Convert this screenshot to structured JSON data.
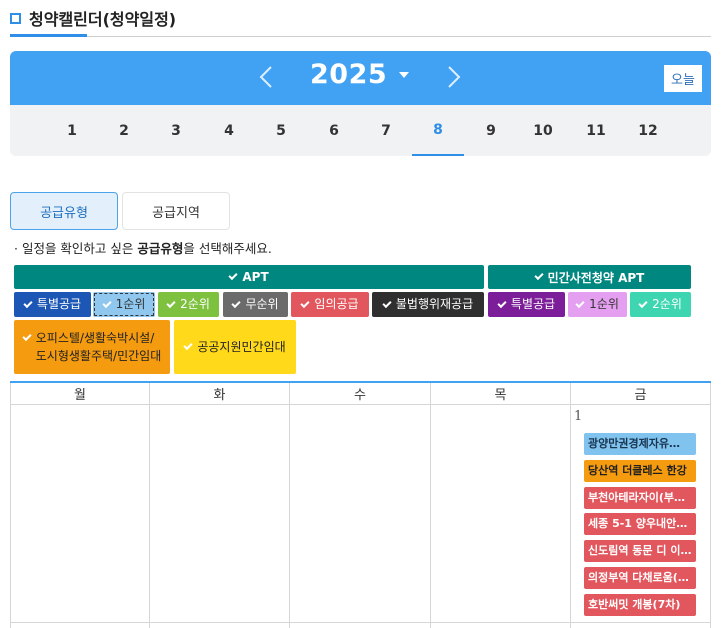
{
  "page_title": "청약캘린더(청약일정)",
  "calendar": {
    "year": "2025",
    "today_label": "오늘",
    "months": [
      "1",
      "2",
      "3",
      "4",
      "5",
      "6",
      "7",
      "8",
      "9",
      "10",
      "11",
      "12"
    ],
    "selected_month": "8"
  },
  "tabs": [
    {
      "label": "공급유형",
      "active": true
    },
    {
      "label": "공급지역",
      "active": false
    }
  ],
  "instruction": {
    "prefix": "· 일정을 확인하고 싶은 ",
    "bold": "공급유형",
    "suffix": "을 선택해주세요."
  },
  "filter_groups": [
    {
      "label": "APT"
    },
    {
      "label": "민간사전청약 APT"
    }
  ],
  "filters": [
    {
      "label": "특별공급",
      "color": "#1c57b5"
    },
    {
      "label": "1순위",
      "color": "#8fc7ee"
    },
    {
      "label": "2순위",
      "color": "#7dc13f"
    },
    {
      "label": "무순위",
      "color": "#6b6b6b"
    },
    {
      "label": "임의공급",
      "color": "#e2575e"
    },
    {
      "label": "불법행위재공급",
      "color": "#2f2f2f"
    },
    {
      "label": "특별공급",
      "color": "#7c1d9a"
    },
    {
      "label": "1순위",
      "color": "#e59ff0"
    },
    {
      "label": "2순위",
      "color": "#3ed6b0"
    },
    {
      "label_lines": [
        "오피스텔/생활숙박시설/",
        "도시형생활주택/민간임대"
      ],
      "color": "#f59b0f"
    },
    {
      "label": "공공지원민간임대",
      "color": "#ffd91a"
    }
  ],
  "weekdays": [
    "월",
    "화",
    "수",
    "목",
    "금"
  ],
  "date": "1",
  "events": [
    {
      "label": "광양만권경제자유…",
      "color": "#7fc3ee"
    },
    {
      "label": "당산역 더클레스 한강",
      "color": "#f59b0f"
    },
    {
      "label": "부천아테라자이(부…",
      "color": "#e2575e"
    },
    {
      "label": "세종 5-1 양우내안…",
      "color": "#e2575e"
    },
    {
      "label": "신도림역 동문 디 이…",
      "color": "#e2575e"
    },
    {
      "label": "의정부역 다채로움(…",
      "color": "#e2575e"
    },
    {
      "label": "호반써밋 개봉(7차)",
      "color": "#e2575e"
    }
  ]
}
